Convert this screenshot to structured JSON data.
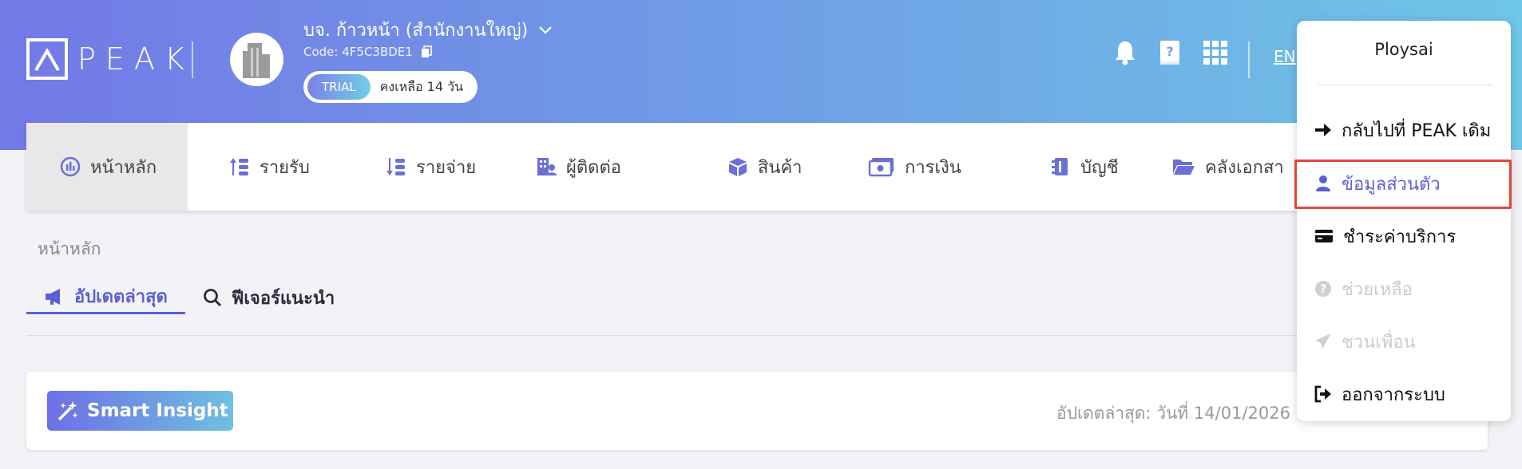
{
  "header": {
    "logo_text": "PEAK",
    "company_name": "บจ. ก้าวหน้า (สำนักงานใหญ่)",
    "company_code": "Code: 4F5C3BDE1",
    "trial_label": "TRIAL",
    "trial_remaining": "คงเหลือ 14 วัน",
    "language": "EN"
  },
  "nav": {
    "items": [
      {
        "label": "หน้าหลัก",
        "icon": "dashboard-icon"
      },
      {
        "label": "รายรับ",
        "icon": "income-icon"
      },
      {
        "label": "รายจ่าย",
        "icon": "expense-icon"
      },
      {
        "label": "ผู้ติดต่อ",
        "icon": "contacts-icon"
      },
      {
        "label": "สินค้า",
        "icon": "box-icon"
      },
      {
        "label": "การเงิน",
        "icon": "money-icon"
      },
      {
        "label": "บัญชี",
        "icon": "accounting-icon"
      },
      {
        "label": "คลังเอกสา",
        "icon": "folder-icon"
      }
    ]
  },
  "breadcrumb": "หน้าหลัก",
  "tabs": [
    {
      "label": "อัปเดตล่าสุด",
      "icon": "megaphone-icon"
    },
    {
      "label": "ฟีเจอร์แนะนำ",
      "icon": "search-icon"
    }
  ],
  "insight": {
    "button_label": "Smart Insight",
    "updated_text": "อัปเดตล่าสุด: วันที่ 14/01/2026"
  },
  "user_menu": {
    "username": "Ploysai",
    "items": [
      {
        "label": "กลับไปที่ PEAK เดิม",
        "icon": "arrow-right-icon"
      },
      {
        "label": "ข้อมูลส่วนตัว",
        "icon": "user-icon"
      },
      {
        "label": "ชำระค่าบริการ",
        "icon": "credit-card-icon"
      },
      {
        "label": "ช่วยเหลือ",
        "icon": "help-icon"
      },
      {
        "label": "ชวนเพื่อน",
        "icon": "send-icon"
      },
      {
        "label": "ออกจากระบบ",
        "icon": "logout-icon"
      }
    ]
  },
  "colors": {
    "accent": "#5b5fd6",
    "highlight": "#e0473a"
  }
}
